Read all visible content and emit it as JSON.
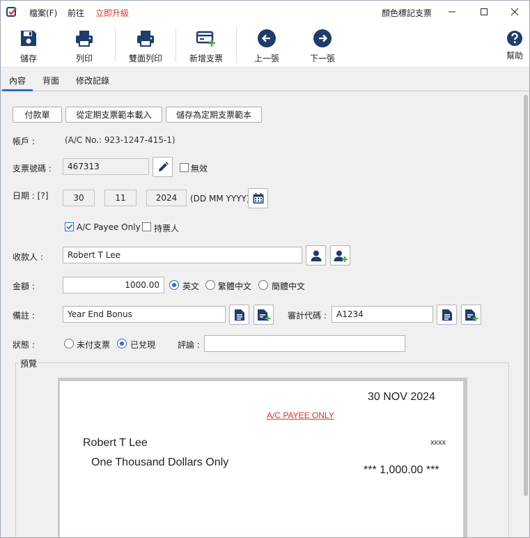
{
  "menu": {
    "file": "檔案(F)",
    "goto": "前往",
    "upgrade": "立即升級"
  },
  "window": {
    "title": "顏色標記支票"
  },
  "toolbar": {
    "save": "儲存",
    "print": "列印",
    "duplex_print": "雙面列印",
    "new_cheque": "新增支票",
    "prev": "上一張",
    "next": "下一張",
    "help": "幫助"
  },
  "tabs": {
    "content": "內容",
    "back": "背面",
    "history": "修改記錄"
  },
  "form": {
    "btn_payment_voucher": "付款單",
    "btn_load_template": "從定期支票範本載入",
    "btn_save_template": "儲存為定期支票範本",
    "account_label": "帳戶 :",
    "account_value": "(A/C No.: 923-1247-415-1)",
    "cheque_no_label": "支票號碼 :",
    "cheque_no_value": "467313",
    "void_label": "無效",
    "date_label": "日期 : [?]",
    "date_day": "30",
    "date_month": "11",
    "date_year": "2024",
    "date_format": "(DD MM YYYY)",
    "ac_payee_label": "A/C Payee Only",
    "bearer_label": "持票人",
    "payee_label": "收款人 :",
    "payee_value": "Robert T Lee",
    "amount_label": "金額 :",
    "amount_value": "1000.00",
    "lang_english": "英文",
    "lang_trad": "繁體中文",
    "lang_simp": "簡體中文",
    "memo_label": "備註 :",
    "memo_value": "Year End Bonus",
    "audit_label": "審計代碼 :",
    "audit_value": "A1234",
    "status_label": "狀態 :",
    "status_unpaid": "未付支票",
    "status_cashed": "已兌現",
    "comment_label": "評論 :",
    "comment_value": ""
  },
  "preview": {
    "title": "預覽",
    "date": "30 NOV 2024",
    "crossing": "A/C PAYEE ONLY",
    "payee": "Robert T Lee",
    "bearer_mark": "xxxx",
    "amount_words": "One Thousand Dollars Only",
    "amount_figure": "*** 1,000.00 ***"
  },
  "colors": {
    "accent": "#2b6cd1",
    "icon_navy": "#1f3c6e",
    "upgrade_red": "#e0332f",
    "crossing_red": "#d9342b",
    "add_green": "#4caf50"
  }
}
